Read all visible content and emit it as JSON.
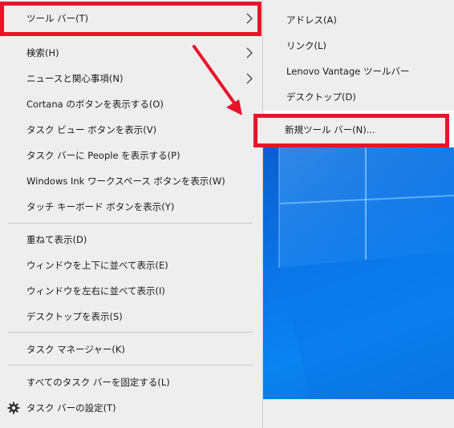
{
  "main_menu": {
    "items": [
      {
        "label": "ツール バー(T)"
      },
      {
        "label": "検索(H)"
      },
      {
        "label": "ニュースと関心事項(N)"
      },
      {
        "label": "Cortana のボタンを表示する(O)"
      },
      {
        "label": "タスク ビュー ボタンを表示(V)"
      },
      {
        "label": "タスク バーに People を表示する(P)"
      },
      {
        "label": "Windows Ink ワークスペース ボタンを表示(W)"
      },
      {
        "label": "タッチ キーボード ボタンを表示(Y)"
      },
      {
        "label": "重ねて表示(D)"
      },
      {
        "label": "ウィンドウを上下に並べて表示(E)"
      },
      {
        "label": "ウィンドウを左右に並べて表示(I)"
      },
      {
        "label": "デスクトップを表示(S)"
      },
      {
        "label": "タスク マネージャー(K)"
      },
      {
        "label": "すべてのタスク バーを固定する(L)"
      },
      {
        "label": "タスク バーの設定(T)"
      }
    ]
  },
  "toolbar_submenu": {
    "items": [
      {
        "label": "アドレス(A)"
      },
      {
        "label": "リンク(L)"
      },
      {
        "label": "Lenovo Vantage ツールバー"
      },
      {
        "label": "デスクトップ(D)"
      },
      {
        "label": "新規ツール バー(N)..."
      }
    ]
  },
  "icons": {
    "submenu_arrow": "chevron-right-icon",
    "settings": "gear-icon"
  },
  "colors": {
    "highlight_border": "#e8142a",
    "wallpaper": "#0b74e6",
    "menu_bg": "#eeeeee"
  }
}
